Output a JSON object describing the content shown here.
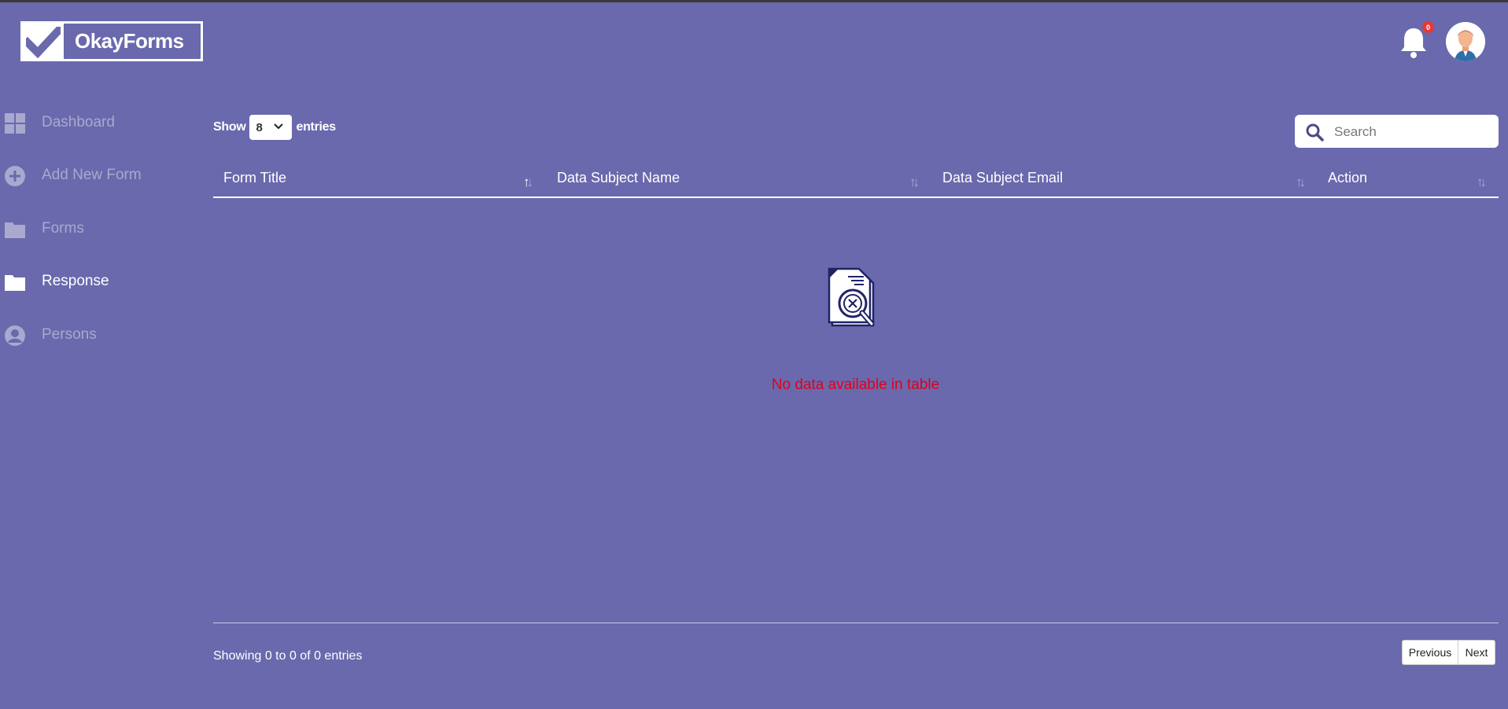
{
  "app": {
    "brand": "OkayForms"
  },
  "header": {
    "notification_count": "0"
  },
  "sidebar": {
    "items": [
      {
        "label": "Dashboard",
        "icon": "dashboard-grid-icon",
        "active": false
      },
      {
        "label": "Add New Form",
        "icon": "plus-circle-icon",
        "active": false
      },
      {
        "label": "Forms",
        "icon": "folder-icon",
        "active": false
      },
      {
        "label": "Response",
        "icon": "folder-icon",
        "active": true
      },
      {
        "label": "Persons",
        "icon": "person-circle-icon",
        "active": false
      }
    ]
  },
  "controls": {
    "show_label": "Show",
    "entries_label": "entries",
    "page_length": "8",
    "search_placeholder": "Search"
  },
  "table": {
    "columns": [
      "Form Title",
      "Data Subject Name",
      "Data Subject Email",
      "Action"
    ],
    "rows": [],
    "empty_message": "No data available in table"
  },
  "footer": {
    "info": "Showing 0 to 0 of 0 entries",
    "previous_label": "Previous",
    "next_label": "Next"
  },
  "colors": {
    "background": "#6a69ad",
    "empty_text": "#e1001b",
    "badge": "#e53935"
  }
}
